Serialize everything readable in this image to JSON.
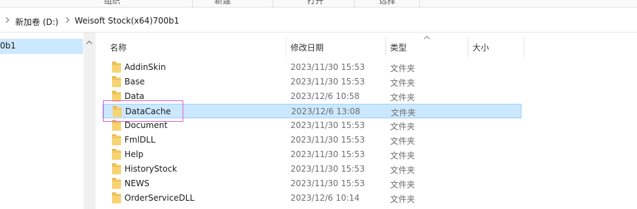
{
  "ribbon": {
    "labels": [
      "组织",
      "新建",
      "打开",
      "选择"
    ]
  },
  "address": {
    "drive": "新加卷 (D:)",
    "folder": "Weisoft Stock(x64)700b1"
  },
  "nav": {
    "selected_label": "0b1"
  },
  "columns": {
    "name": "名称",
    "date": "修改日期",
    "type": "类型",
    "size": "大小"
  },
  "files": [
    {
      "name": "AddinSkin",
      "date": "2023/11/30 15:53",
      "type": "文件夹"
    },
    {
      "name": "Base",
      "date": "2023/11/30 15:53",
      "type": "文件夹"
    },
    {
      "name": "Data",
      "date": "2023/12/6 10:58",
      "type": "文件夹"
    },
    {
      "name": "DataCache",
      "date": "2023/12/6 13:08",
      "type": "文件夹",
      "selected": true
    },
    {
      "name": "Document",
      "date": "2023/11/30 15:53",
      "type": "文件夹"
    },
    {
      "name": "FmlDLL",
      "date": "2023/11/30 15:53",
      "type": "文件夹"
    },
    {
      "name": "Help",
      "date": "2023/11/30 15:53",
      "type": "文件夹"
    },
    {
      "name": "HistoryStock",
      "date": "2023/11/30 15:53",
      "type": "文件夹"
    },
    {
      "name": "NEWS",
      "date": "2023/11/30 15:53",
      "type": "文件夹"
    },
    {
      "name": "OrderServiceDLL",
      "date": "2023/12/6 10:14",
      "type": "文件夹"
    }
  ],
  "colors": {
    "selection": "#cce8ff",
    "selection_border": "#99d1ff",
    "folder": "#f7d372",
    "annotation": "#e05ad2"
  }
}
